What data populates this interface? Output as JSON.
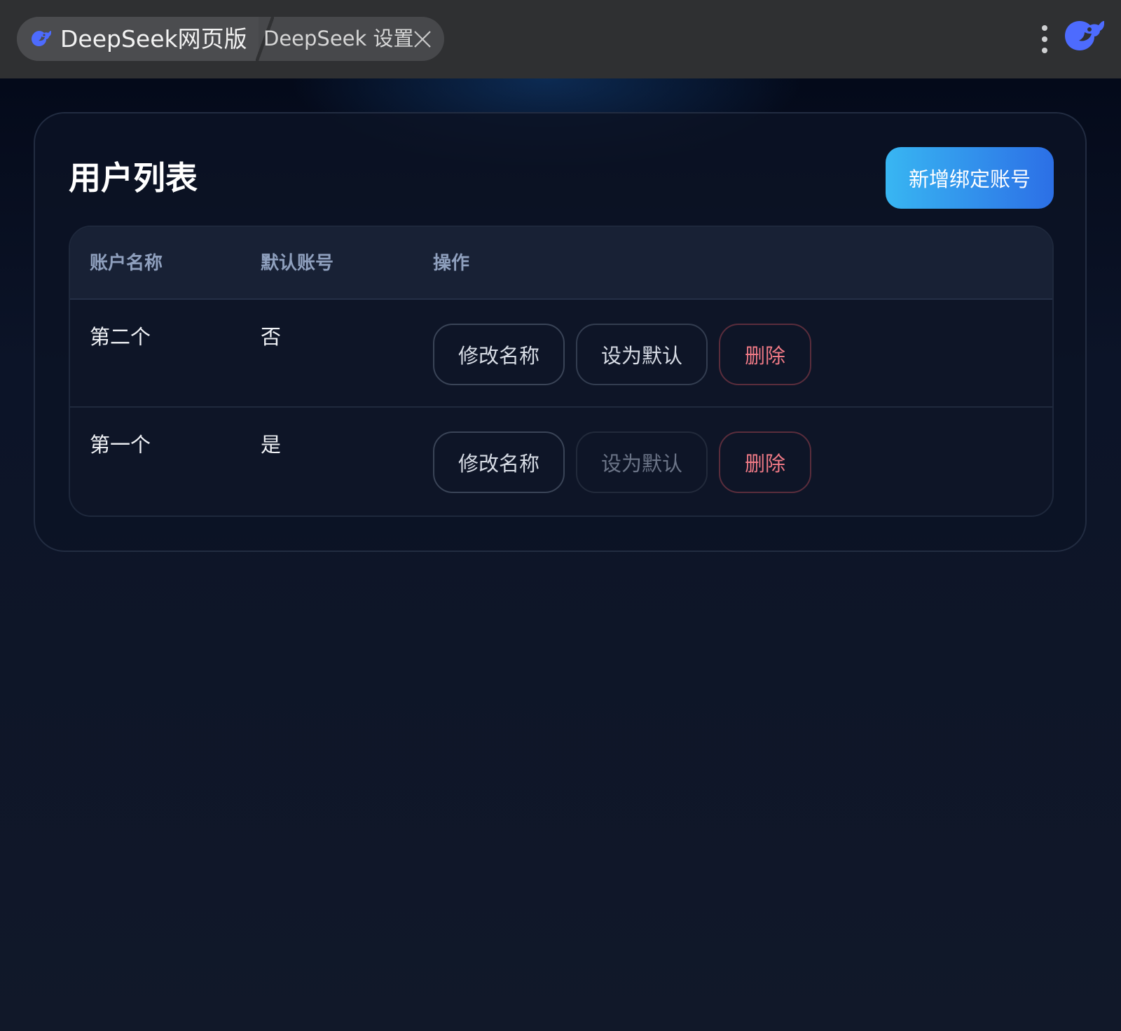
{
  "titlebar": {
    "tab_active_title": "DeepSeek网页版",
    "tab_settings_title": "DeepSeek 设置",
    "logo_icon": "deepseek-whale-icon",
    "accent_color": "#4d6bfe"
  },
  "card": {
    "title": "用户列表",
    "add_button_label": "新增绑定账号"
  },
  "table": {
    "headers": [
      "账户名称",
      "默认账号",
      "操作"
    ],
    "rows": [
      {
        "name": "第二个",
        "is_default": "否",
        "actions": {
          "rename": "修改名称",
          "set_default": "设为默认",
          "delete": "删除",
          "set_default_disabled": false
        }
      },
      {
        "name": "第一个",
        "is_default": "是",
        "actions": {
          "rename": "修改名称",
          "set_default": "设为默认",
          "delete": "删除",
          "set_default_disabled": true
        }
      }
    ]
  },
  "colors": {
    "primary_gradient_start": "#38b6f2",
    "primary_gradient_end": "#2c6fe6",
    "danger": "#f07a86",
    "background": "#0f1628"
  }
}
